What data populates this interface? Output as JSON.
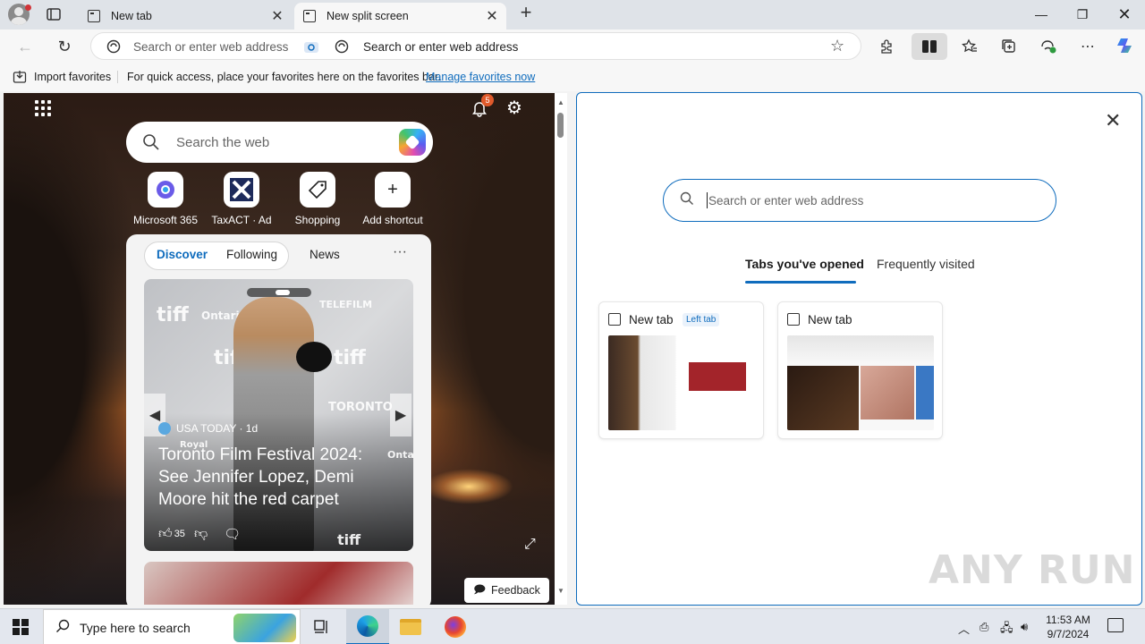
{
  "browser": {
    "tabs": [
      {
        "label": "New tab"
      },
      {
        "label": "New split screen"
      }
    ],
    "address_placeholder_left": "Search or enter web address",
    "address_placeholder_right": "Search or enter web address"
  },
  "favorites_bar": {
    "import_label": "Import favorites",
    "hint_text": "For quick access, place your favorites here on the favorites bar.",
    "manage_link": "Manage favorites now"
  },
  "left_pane": {
    "notification_count": "5",
    "search_placeholder": "Search the web",
    "shortcuts": [
      {
        "label": "Microsoft 365",
        "icon": "microsoft-365-icon"
      },
      {
        "label": "TaxACT · Ad",
        "icon": "taxact-icon"
      },
      {
        "label": "Shopping",
        "icon": "tag-icon"
      },
      {
        "label": "Add shortcut",
        "icon": "plus-icon"
      }
    ],
    "feed_tabs": [
      "Discover",
      "Following",
      "News"
    ],
    "hero_story": {
      "source": "USA TODAY · 1d",
      "headline": "Toronto Film Festival 2024: See Jennifer Lopez, Demi Moore hit the red carpet",
      "likes": "35",
      "brand_words": [
        "tiff",
        "Ontario",
        "TELEFILM",
        "tiff",
        "tiff",
        "TORONTO",
        "Royal",
        "Onta",
        "tiff"
      ]
    },
    "feedback_label": "Feedback"
  },
  "right_pane": {
    "search_placeholder": "Search or enter web address",
    "tabs": [
      "Tabs you've opened",
      "Frequently visited"
    ],
    "cards": [
      {
        "title": "New tab",
        "badge": "Left tab"
      },
      {
        "title": "New tab"
      }
    ]
  },
  "watermark": "ANY RUN",
  "taskbar": {
    "search_placeholder": "Type here to search",
    "time": "11:53 AM",
    "date": "9/7/2024"
  },
  "colors": {
    "accent": "#0f6cbd",
    "badge": "#e05a2b"
  }
}
